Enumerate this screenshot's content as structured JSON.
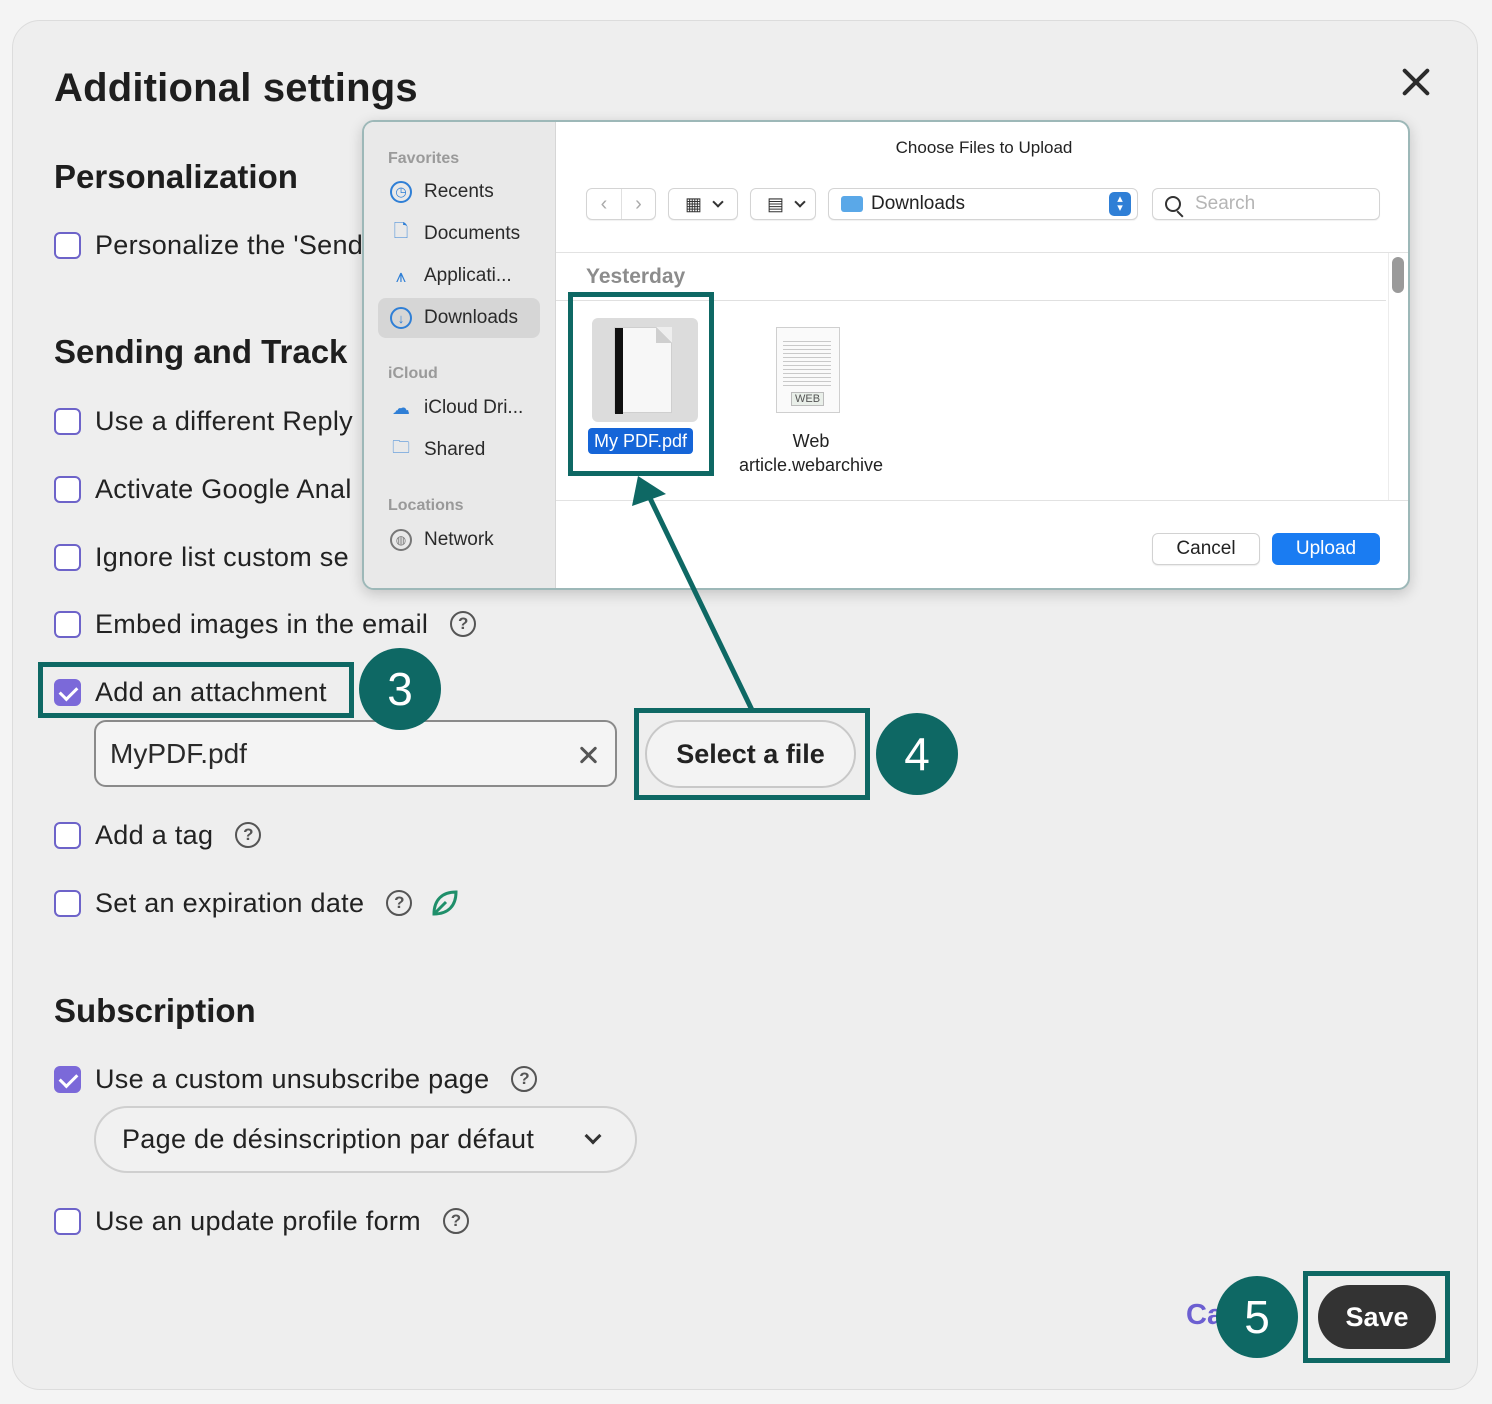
{
  "modal": {
    "title": "Additional settings",
    "sections": {
      "personalization": "Personalization",
      "sending": "Sending and Track",
      "subscription": "Subscription"
    },
    "options": {
      "personalize": "Personalize the 'Send",
      "reply_to": "Use a different Reply",
      "google_analytics": "Activate Google Anal",
      "ignore_list": "Ignore list custom se",
      "embed_images": "Embed images in the email",
      "add_attachment": "Add an attachment",
      "add_tag": "Add a tag",
      "expiration": "Set an expiration date",
      "custom_unsubscribe": "Use a custom unsubscribe page",
      "update_profile": "Use an update profile form"
    },
    "checked": {
      "add_attachment": true,
      "custom_unsubscribe": true
    },
    "help_glyph": "?",
    "attachment_value": "MyPDF.pdf",
    "select_file_label": "Select a file",
    "unsubscribe_select_value": "Page de désinscription par défaut",
    "cancel_label": "Ca",
    "save_label": "Save"
  },
  "steps": {
    "three": "3",
    "four": "4",
    "five": "5"
  },
  "file_dialog": {
    "title": "Choose Files to Upload",
    "sidebar": {
      "favorites_header": "Favorites",
      "favorites": [
        "Recents",
        "Documents",
        "Applicati...",
        "Downloads"
      ],
      "icloud_header": "iCloud",
      "icloud": [
        "iCloud Dri...",
        "Shared"
      ],
      "locations_header": "Locations",
      "locations": [
        "Network"
      ]
    },
    "location": "Downloads",
    "search_placeholder": "Search",
    "group_header": "Yesterday",
    "files": {
      "pdf": "My PDF.pdf",
      "web_line1": "Web",
      "web_line2": "article.webarchive",
      "web_tag": "WEB"
    },
    "cancel_label": "Cancel",
    "upload_label": "Upload"
  },
  "colors": {
    "highlight": "#0e6864",
    "checkbox_accent": "#7b69d9",
    "upload_blue": "#1a7cf2",
    "save_dark": "#333333"
  }
}
